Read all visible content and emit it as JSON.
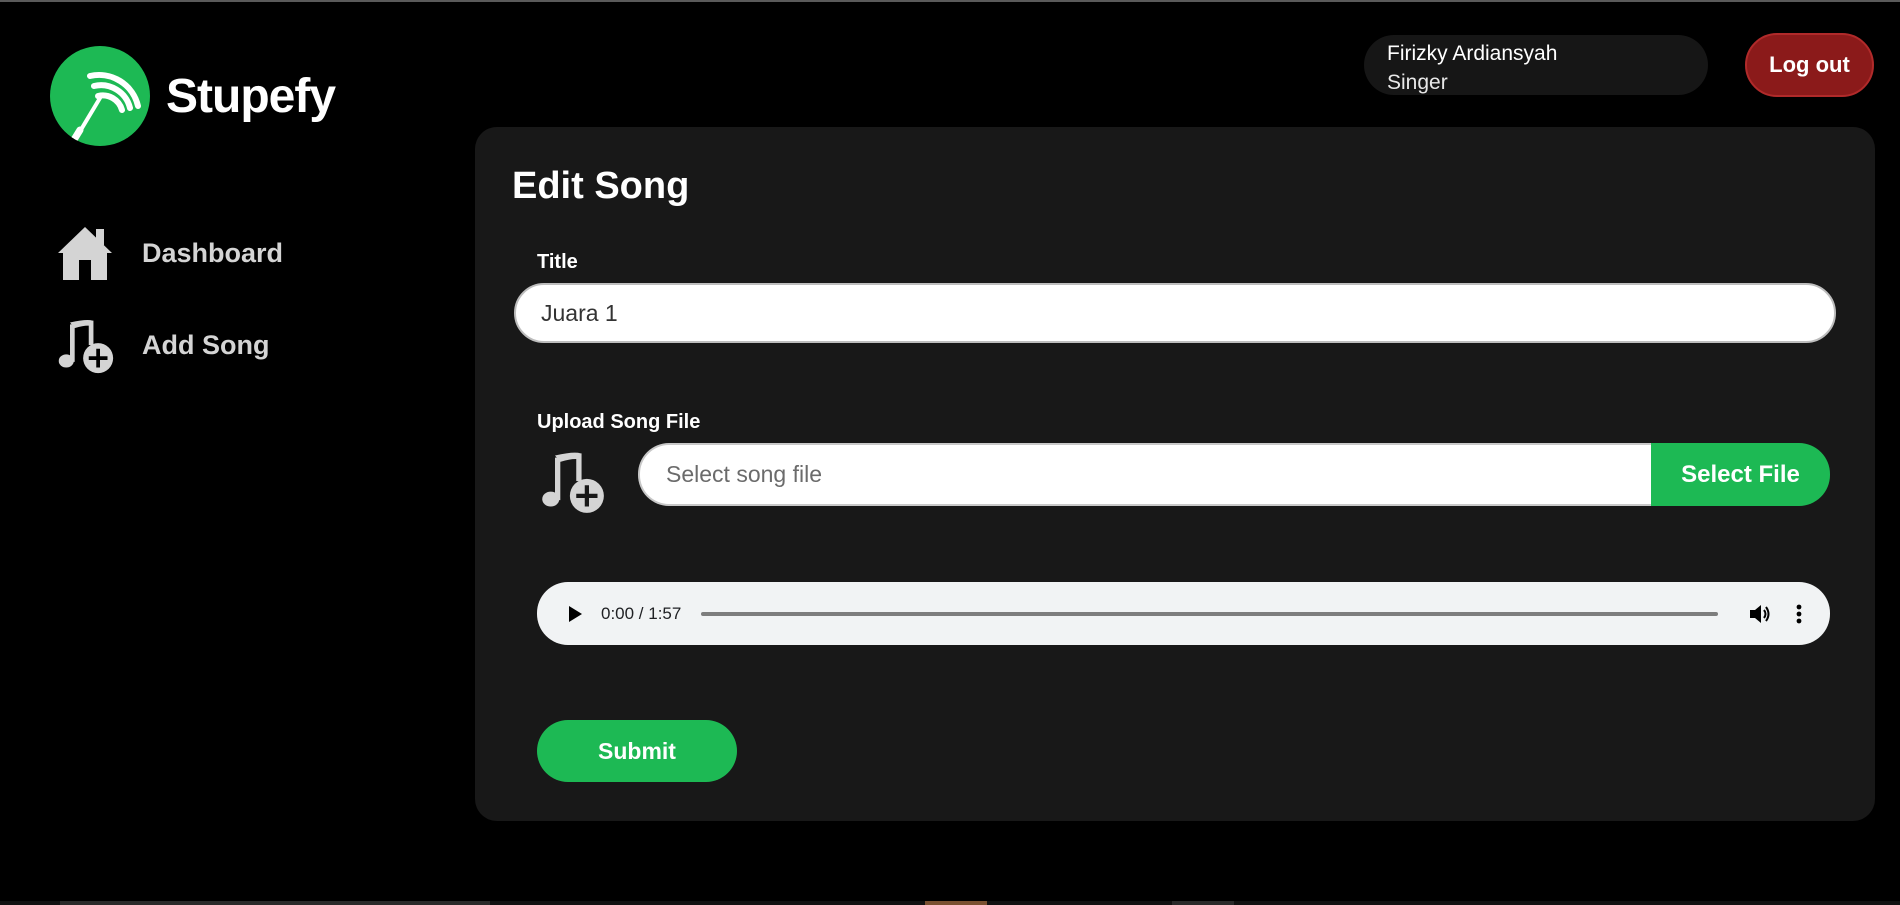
{
  "brand": {
    "name": "Stupefy",
    "logo_icon": "conductor-baton-logo-icon",
    "accent_color": "#1db954"
  },
  "sidebar": {
    "items": [
      {
        "label": "Dashboard",
        "icon": "home-icon"
      },
      {
        "label": "Add Song",
        "icon": "music-add-icon"
      }
    ]
  },
  "header": {
    "user_name": "Firizky Ardiansyah",
    "user_role": "Singer",
    "logout_label": "Log out",
    "logout_color": "#8b1a1a"
  },
  "form": {
    "title": "Edit Song",
    "title_label": "Title",
    "title_value": "Juara 1",
    "upload_label": "Upload Song File",
    "upload_icon": "music-add-icon",
    "file_placeholder": "Select song file",
    "select_file_label": "Select File",
    "submit_label": "Submit"
  },
  "audio": {
    "time": "0:00 / 1:57",
    "progress": 0
  }
}
